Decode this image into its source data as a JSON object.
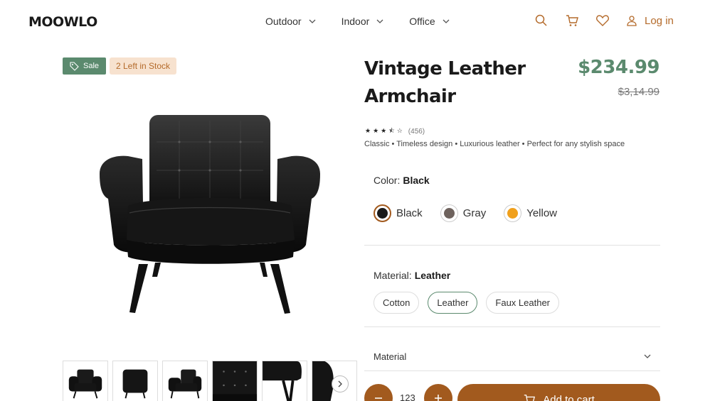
{
  "header": {
    "logo": "MOOWLO",
    "nav": [
      {
        "label": "Outdoor"
      },
      {
        "label": "Indoor"
      },
      {
        "label": "Office"
      }
    ],
    "login_label": "Log in"
  },
  "badges": {
    "sale": "Sale",
    "stock": "2 Left in Stock"
  },
  "product": {
    "title": "Vintage Leather Armchair",
    "price": "$234.99",
    "old_price": "$3,14.99",
    "rating_stars": 3.5,
    "rating_count": "(456)",
    "tagline": "Classic • Timeless design • Luxurious leather • Perfect for any stylish space"
  },
  "color": {
    "label": "Color:",
    "selected": "Black",
    "options": [
      {
        "name": "Black",
        "hex": "#1a1a1a"
      },
      {
        "name": "Gray",
        "hex": "#6e625d"
      },
      {
        "name": "Yellow",
        "hex": "#f0a01c"
      }
    ]
  },
  "material": {
    "label": "Material:",
    "selected": "Leather",
    "options": [
      {
        "name": "Cotton"
      },
      {
        "name": "Leather"
      },
      {
        "name": "Faux Leather"
      }
    ],
    "accordion_label": "Material"
  },
  "cart": {
    "quantity": "123",
    "add_label": "Add to cart"
  },
  "colors": {
    "accent": "#a25a1e",
    "brand_green": "#5b8a6e",
    "stock_bg": "#f7e2cf"
  }
}
